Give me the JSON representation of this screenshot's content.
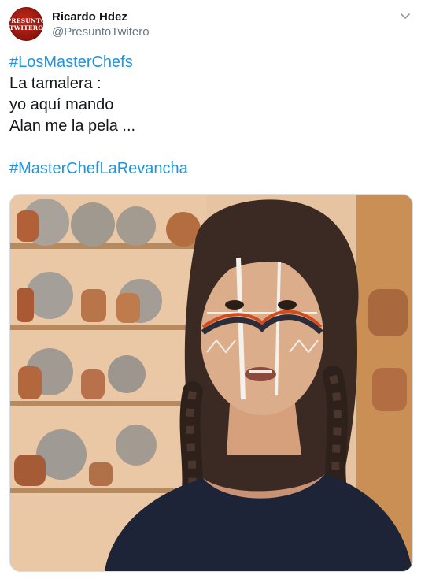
{
  "author": {
    "avatar_text": [
      "PRESUNTO",
      "TWITERO"
    ],
    "display_name": "Ricardo Hdez",
    "handle": "@PresuntoTwitero"
  },
  "tweet": {
    "hashtag_top": "#LosMasterChefs",
    "lines": [
      "La tamalera :",
      "yo aquí mando",
      "Alan me la pela ..."
    ],
    "hashtag_bottom": "#MasterChefLaRevancha"
  },
  "media": {
    "description_icon": "photo"
  },
  "icons": {
    "menu": "chevron-down-icon"
  },
  "colors": {
    "link": "#1b95e0",
    "text": "#14171a",
    "secondary": "#657786",
    "avatar": "#a3190e"
  }
}
